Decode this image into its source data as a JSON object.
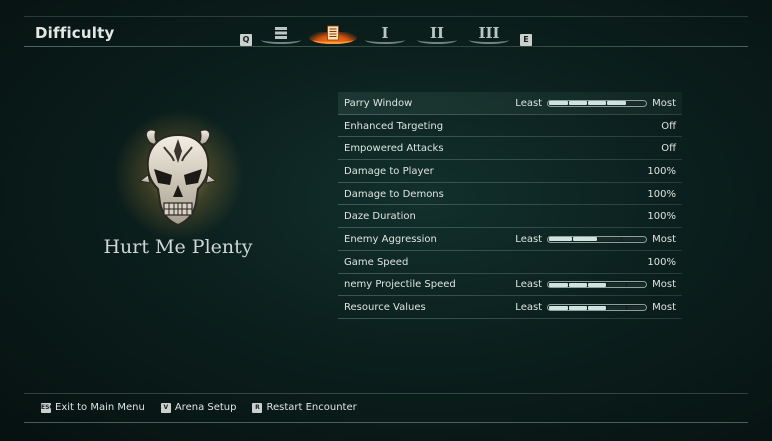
{
  "header": {
    "title": "Difficulty",
    "left_key": "Q",
    "right_key": "E",
    "tabs": [
      {
        "icon": "stack-icon",
        "label": ""
      },
      {
        "icon": "book-icon",
        "label": "",
        "active": true
      },
      {
        "icon": "",
        "label": "I"
      },
      {
        "icon": "",
        "label": "II"
      },
      {
        "icon": "",
        "label": "III"
      }
    ]
  },
  "difficulty": {
    "name": "Hurt Me Plenty",
    "icon": "demon-skull-icon"
  },
  "settings": [
    {
      "label": "Parry Window",
      "type": "slider",
      "min_label": "Least",
      "max_label": "Most",
      "filled": 4,
      "total": 5
    },
    {
      "label": "Enhanced Targeting",
      "type": "value",
      "value": "Off"
    },
    {
      "label": "Empowered Attacks",
      "type": "value",
      "value": "Off"
    },
    {
      "label": "Damage to Player",
      "type": "value",
      "value": "100%"
    },
    {
      "label": "Damage to Demons",
      "type": "value",
      "value": "100%"
    },
    {
      "label": "Daze Duration",
      "type": "value",
      "value": "100%"
    },
    {
      "label": "Enemy Aggression",
      "type": "slider",
      "min_label": "Least",
      "max_label": "Most",
      "filled": 2,
      "total": 4
    },
    {
      "label": "Game Speed",
      "type": "value",
      "value": "100%"
    },
    {
      "label": "nemy Projectile Speed",
      "type": "slider",
      "min_label": "Least",
      "max_label": "Most",
      "filled": 3,
      "total": 5
    },
    {
      "label": "Resource Values",
      "type": "slider",
      "min_label": "Least",
      "max_label": "Most",
      "filled": 3,
      "total": 5
    }
  ],
  "footer": [
    {
      "key": "ESC",
      "label": "Exit to Main Menu"
    },
    {
      "key": "V",
      "label": "Arena Setup"
    },
    {
      "key": "R",
      "label": "Restart Encounter"
    }
  ],
  "colors": {
    "accent": "#ff8a1c",
    "slider_fill": "#cfe3df",
    "background": "#0b1f1d"
  }
}
